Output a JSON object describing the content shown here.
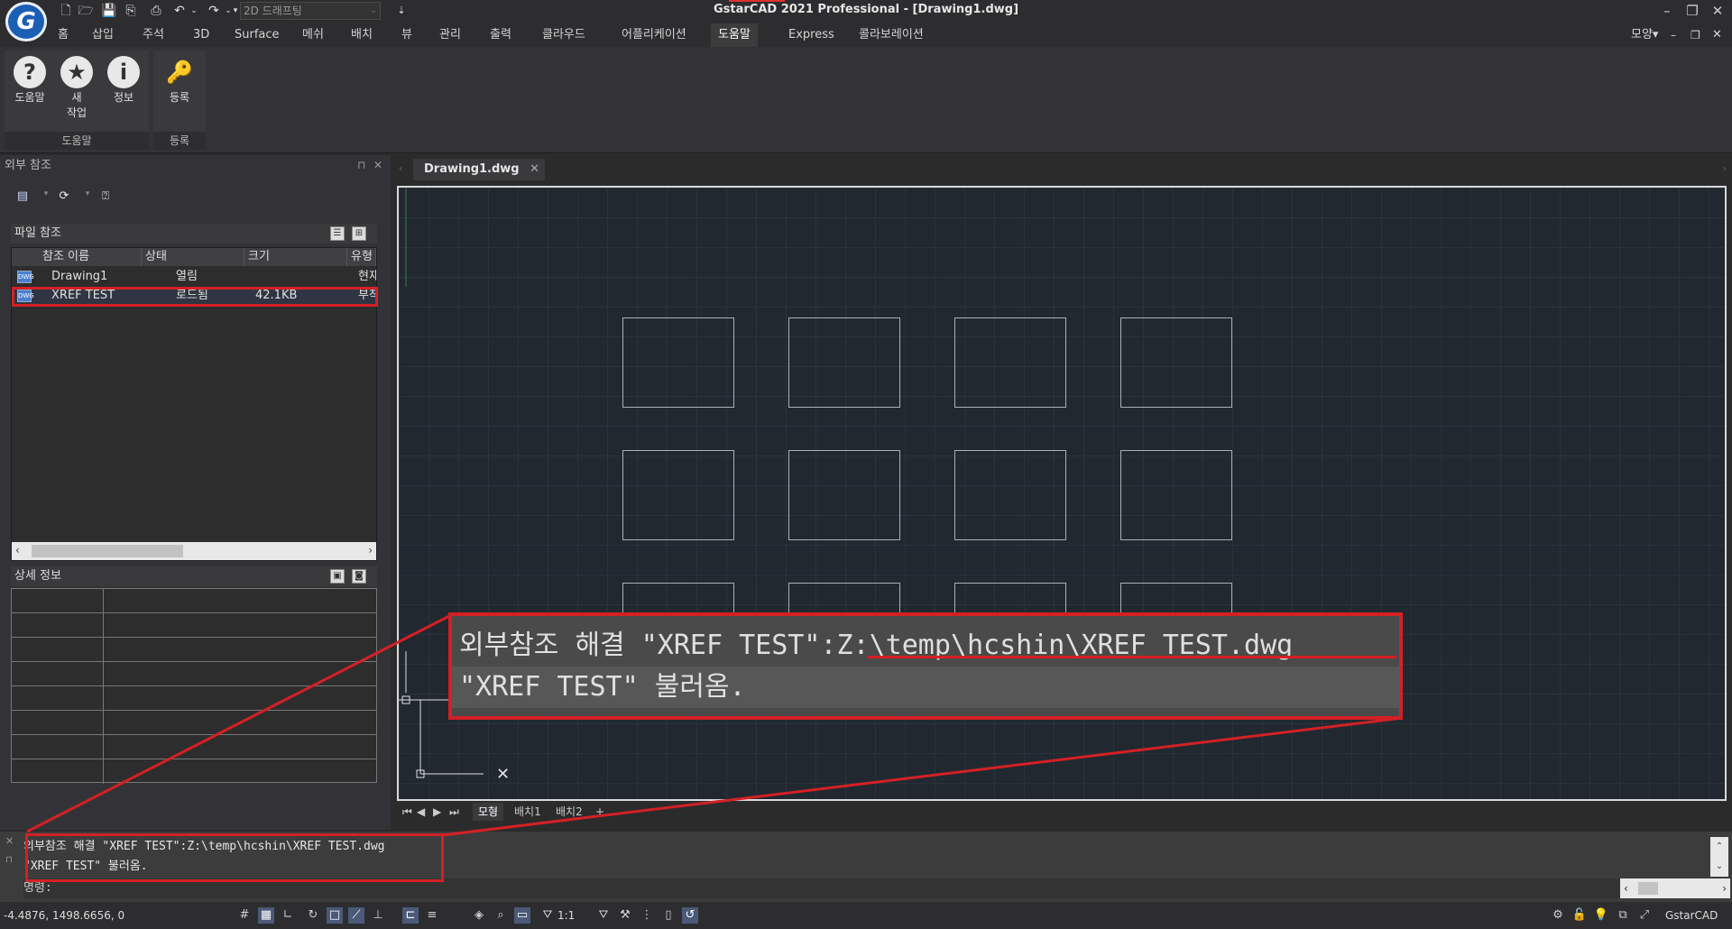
{
  "app": {
    "title": "GstarCAD 2021 Professional - [Drawing1.dwg]",
    "logo_text": "G",
    "workspace": "2D 드래프팅",
    "quick_access": [
      "new-file-icon",
      "open-file-icon",
      "save-icon",
      "save-as-icon",
      "print-icon",
      "undo-icon",
      "redo-icon"
    ]
  },
  "menu": {
    "tabs": [
      "홈",
      "삽입",
      "주석",
      "3D",
      "Surface",
      "메쉬",
      "배치",
      "뷰",
      "관리",
      "출력",
      "클라우드",
      "어플리케이션",
      "도움말",
      "Express",
      "콜라보레이션"
    ],
    "active": "도움말",
    "right_label": "모양▾"
  },
  "ribbon": {
    "groups": [
      {
        "label": "도움말",
        "buttons": [
          {
            "label": "도움말",
            "icon": "?"
          },
          {
            "label": "새\n작업",
            "icon": "★"
          },
          {
            "label": "정보",
            "icon": "i"
          }
        ]
      },
      {
        "label": "등록",
        "buttons": [
          {
            "label": "등록",
            "icon": "🔑"
          }
        ]
      }
    ]
  },
  "xref_panel": {
    "title": "외부 참조",
    "file_section": "파일 참조",
    "columns": [
      "참조 이름",
      "상태",
      "크기",
      "유형"
    ],
    "rows": [
      {
        "name": "Drawing1",
        "status": "열림",
        "size": "",
        "type": "현재"
      },
      {
        "name": "XREF TEST",
        "status": "로드됨",
        "size": "42.1KB",
        "type": "부착"
      }
    ],
    "detail_section": "상세 정보"
  },
  "document": {
    "tab": "Drawing1.dwg",
    "layout_tabs": [
      "모형",
      "배치1",
      "배치2"
    ]
  },
  "callout": {
    "line1_prefix": "외부참조 해결 \"XREF TEST\":",
    "line1_path": "Z:\\temp\\hcshin\\XREF TEST.dwg",
    "line2": "\"XREF TEST\" 불러옴."
  },
  "command": {
    "line1": "외부참조 해결 \"XREF TEST\":Z:\\temp\\hcshin\\XREF TEST.dwg",
    "line2": "\"XREF TEST\" 불러옴.",
    "prompt": "명령:"
  },
  "status": {
    "coords": "-4.4876, 1498.6656, 0",
    "scale": "1:1",
    "brand": "GstarCAD"
  },
  "colors": {
    "highlight": "#d42025",
    "canvas_bg": "#212830",
    "accent": "#1a5fb4"
  }
}
